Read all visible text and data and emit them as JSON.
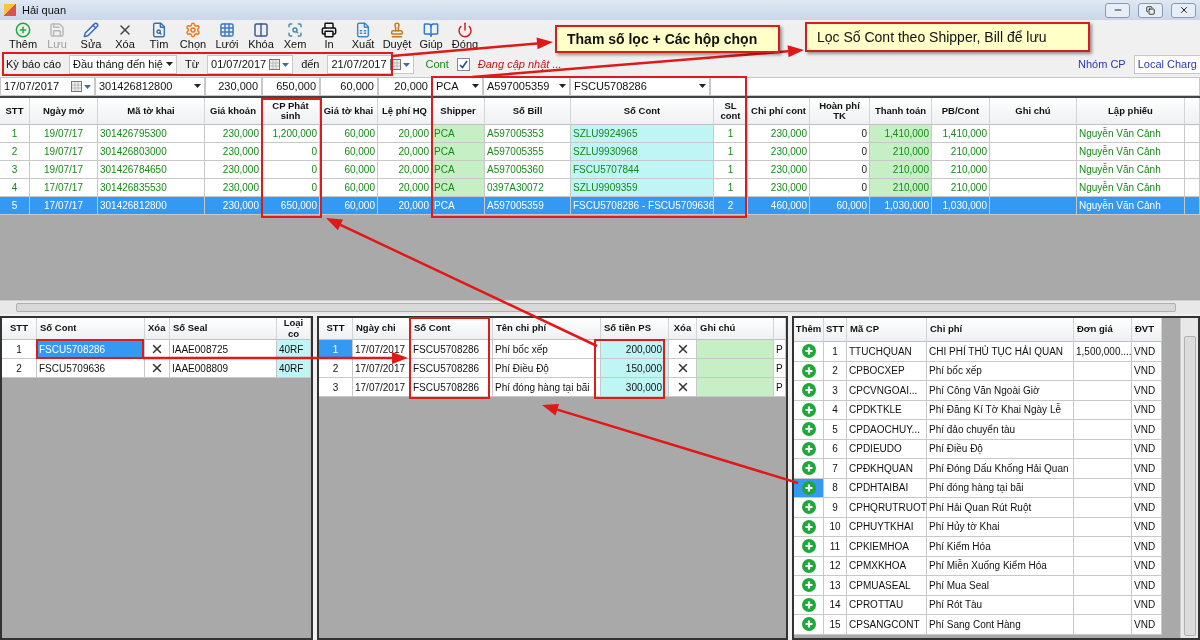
{
  "window": {
    "title": "Hải quan"
  },
  "toolbar": [
    {
      "label": "Thêm",
      "disabled": false
    },
    {
      "label": "Lưu",
      "disabled": true
    },
    {
      "label": "Sửa",
      "disabled": false
    },
    {
      "label": "Xóa",
      "disabled": false
    },
    {
      "label": "Tìm",
      "disabled": false
    },
    {
      "label": "Chọn",
      "disabled": false
    },
    {
      "label": "Lưới",
      "disabled": false
    },
    {
      "label": "Khóa",
      "disabled": false
    },
    {
      "label": "Xem",
      "disabled": false
    },
    {
      "label": "In",
      "disabled": false
    },
    {
      "label": "Xuất",
      "disabled": false
    },
    {
      "label": "Duyệt",
      "disabled": false
    },
    {
      "label": "Giúp",
      "disabled": false
    },
    {
      "label": "Đóng",
      "disabled": false
    }
  ],
  "annotations": [
    {
      "text": "Tham số lọc + Các hộp chọn"
    },
    {
      "text": "Lọc Số Cont theo Shipper, Bill để lưu"
    }
  ],
  "filter": {
    "period_label": "Kỳ báo cáo",
    "period_value": "Đầu tháng đến hiệ",
    "from_label": "Từ",
    "from_value": "01/07/2017",
    "to_label": "đến",
    "to_value": "21/07/2017",
    "cont_label": "Cont",
    "cont_checked": true,
    "status": "Đang cập nhật ...",
    "group_label": "Nhóm CP",
    "group_value": "Local Charg"
  },
  "edit_row": {
    "date": "17/07/2017",
    "declaration": "301426812800",
    "values": [
      "230,000",
      "650,000",
      "60,000",
      "20,000"
    ],
    "shipper": "PCA",
    "bill": "A597005359",
    "cont": "FSCU5708286"
  },
  "main_grid": {
    "columns": [
      "STT",
      "Ngày mở",
      "Mã tờ khai",
      "Giá khoản",
      "CP Phát sinh",
      "Giá tờ khai",
      "Lệ phí HQ",
      "Shipper",
      "Số Bill",
      "Số Cont",
      "SL cont",
      "Chi phí cont",
      "Hoàn phí TK",
      "Thanh toán",
      "PB/Cont",
      "Ghi chú",
      "Lập phiếu"
    ],
    "rows": [
      {
        "selected": false,
        "cells": [
          "1",
          "19/07/17",
          "301426795300",
          "230,000",
          "1,200,000",
          "60,000",
          "20,000",
          "PCA",
          "A597005353",
          "SZLU9924965",
          "1",
          "230,000",
          "0",
          "1,410,000",
          "1,410,000",
          null,
          "Nguyễn Văn Cảnh"
        ]
      },
      {
        "selected": false,
        "cells": [
          "2",
          "19/07/17",
          "301426803000",
          "230,000",
          "0",
          "60,000",
          "20,000",
          "PCA",
          "A597005355",
          "SZLU9930968",
          "1",
          "230,000",
          "0",
          "210,000",
          "210,000",
          null,
          "Nguyễn Văn Cảnh"
        ]
      },
      {
        "selected": false,
        "cells": [
          "3",
          "19/07/17",
          "301426784650",
          "230,000",
          "0",
          "60,000",
          "20,000",
          "PCA",
          "A597005360",
          "FSCU5707844",
          "1",
          "230,000",
          "0",
          "210,000",
          "210,000",
          null,
          "Nguyễn Văn Cảnh"
        ]
      },
      {
        "selected": false,
        "cells": [
          "4",
          "17/07/17",
          "301426835530",
          "230,000",
          "0",
          "60,000",
          "20,000",
          "PCA",
          "0397A30072",
          "SZLU9909359",
          "1",
          "230,000",
          "0",
          "210,000",
          "210,000",
          null,
          "Nguyễn Văn Cảnh"
        ]
      },
      {
        "selected": true,
        "cells": [
          "5",
          "17/07/17",
          "301426812800",
          "230,000",
          "650,000",
          "60,000",
          "20,000",
          "PCA",
          "A597005359",
          "FSCU5708286 - FSCU5709636",
          "2",
          "460,000",
          "60,000",
          "1,030,000",
          "1,030,000",
          null,
          "Nguyễn Văn Cảnh"
        ]
      }
    ]
  },
  "containers": {
    "columns": [
      "STT",
      "Số Cont",
      "Xóa",
      "Số Seal",
      "Loại co"
    ],
    "rows": [
      {
        "selected": true,
        "stt": "1",
        "cont": "FSCU5708286",
        "seal": "IAAE008725",
        "type": "40RF"
      },
      {
        "selected": false,
        "stt": "2",
        "cont": "FSCU5709636",
        "seal": "IAAE008809",
        "type": "40RF"
      }
    ]
  },
  "expenses": {
    "columns": [
      "STT",
      "Ngày chi",
      "Số Cont",
      "Tên chi phí",
      "Số tiền PS",
      "Xóa",
      "Ghi chú"
    ],
    "rows": [
      {
        "selected": true,
        "stt": "1",
        "date": "17/07/2017",
        "cont": "FSCU5708286",
        "name": "Phí bốc xếp",
        "amount": "200,000",
        "tail": "P"
      },
      {
        "selected": false,
        "stt": "2",
        "date": "17/07/2017",
        "cont": "FSCU5708286",
        "name": "Phí Điều Độ",
        "amount": "150,000",
        "tail": "P"
      },
      {
        "selected": false,
        "stt": "3",
        "date": "17/07/2017",
        "cont": "FSCU5708286",
        "name": "Phí đóng hàng tại bãi",
        "amount": "300,000",
        "tail": "P"
      }
    ]
  },
  "catalog": {
    "columns": [
      "Thêm",
      "STT",
      "Mã CP",
      "Chi phí",
      "Đơn giá",
      "ĐVT"
    ],
    "rows": [
      {
        "selected": false,
        "stt": "1",
        "code": "TTUCHQUAN",
        "name": "CHI PHÍ THỦ TỤC HẢI QUAN",
        "price": "1,500,000....",
        "unit": "VND"
      },
      {
        "selected": false,
        "stt": "2",
        "code": "CPBOCXEP",
        "name": "Phí bốc xếp",
        "unit": "VND"
      },
      {
        "selected": false,
        "stt": "3",
        "code": "CPCVNGOAI...",
        "name": "Phí Công Văn Ngoài Giờ",
        "unit": "VND"
      },
      {
        "selected": false,
        "stt": "4",
        "code": "CPDKTKLE",
        "name": "Phí Đăng Kí Tờ Khai Ngày Lễ",
        "unit": "VND"
      },
      {
        "selected": false,
        "stt": "5",
        "code": "CPDAOCHUY...",
        "name": "Phí đảo chuyển tàu",
        "unit": "VND"
      },
      {
        "selected": false,
        "stt": "6",
        "code": "CPDIEUDO",
        "name": "Phí Điều Độ",
        "unit": "VND"
      },
      {
        "selected": false,
        "stt": "7",
        "code": "CPĐKHQUAN",
        "name": "Phí Đóng Dấu Khống Hải Quan",
        "unit": "VND"
      },
      {
        "selected": true,
        "stt": "8",
        "code": "CPDHTAIBAI",
        "name": "Phí đóng hàng tại bãi",
        "unit": "VND"
      },
      {
        "selected": false,
        "stt": "9",
        "code": "CPHQRUTRUOT",
        "name": "Phí Hải Quan Rút Ruột",
        "unit": "VND"
      },
      {
        "selected": false,
        "stt": "10",
        "code": "CPHUYTKHAI",
        "name": "Phí Hủy tờ Khai",
        "unit": "VND"
      },
      {
        "selected": false,
        "stt": "11",
        "code": "CPKIEMHOA",
        "name": "Phí Kiểm Hóa",
        "unit": "VND"
      },
      {
        "selected": false,
        "stt": "12",
        "code": "CPMXKHOA",
        "name": "Phí Miễn Xuống Kiểm Hóa",
        "unit": "VND"
      },
      {
        "selected": false,
        "stt": "13",
        "code": "CPMUASEAL",
        "name": "Phí Mua Seal",
        "unit": "VND"
      },
      {
        "selected": false,
        "stt": "14",
        "code": "CPROTTAU",
        "name": "Phí Rót Tàu",
        "unit": "VND"
      },
      {
        "selected": false,
        "stt": "15",
        "code": "CPSANGCONT",
        "name": "Phí Sang Cont Hàng",
        "unit": "VND"
      }
    ]
  }
}
